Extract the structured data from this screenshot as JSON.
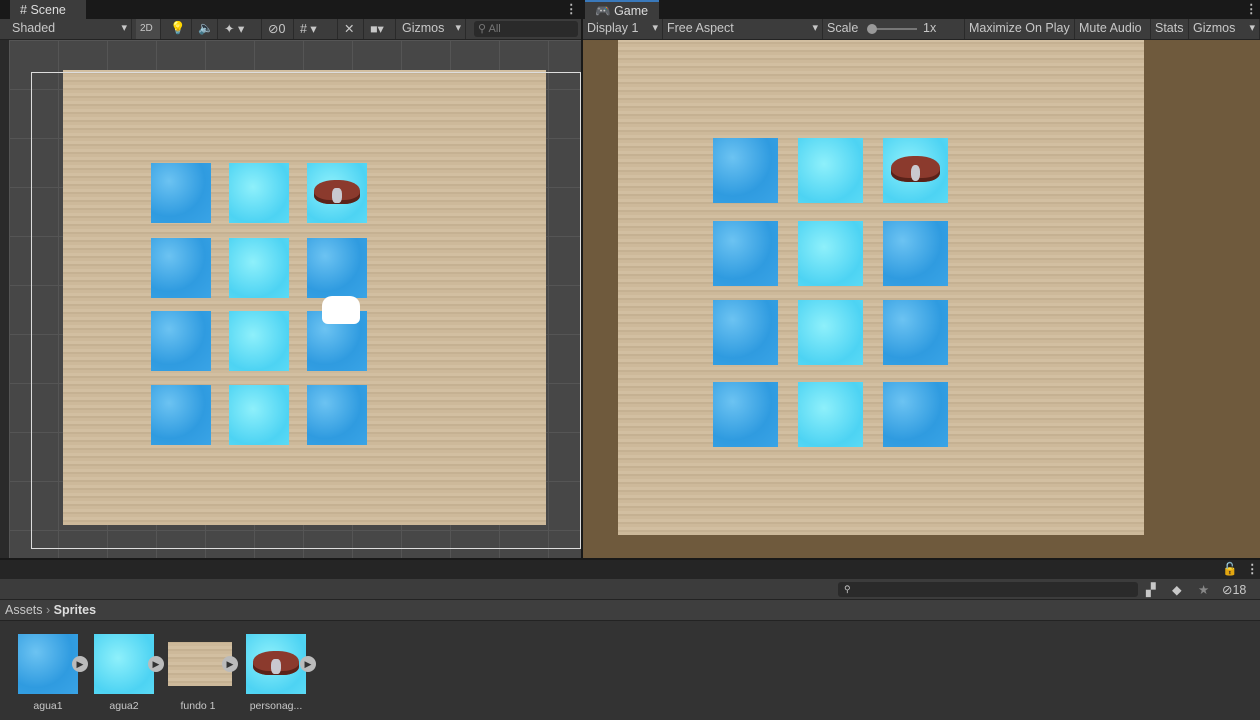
{
  "scene": {
    "tab_label": "Scene",
    "shading_mode": "Shaded",
    "btn_2d": "2D",
    "hidden_count": "0",
    "gizmos": "Gizmos",
    "search_placeholder": "All",
    "grid": [
      [
        "agua1",
        "agua2",
        "personagem"
      ],
      [
        "agua1",
        "agua2",
        "agua1"
      ],
      [
        "agua1",
        "agua2",
        "agua1"
      ],
      [
        "agua1",
        "agua2",
        "agua1"
      ]
    ]
  },
  "game": {
    "tab_label": "Game",
    "display": "Display 1",
    "aspect": "Free Aspect",
    "scale_label": "Scale",
    "scale_value": "1x",
    "scale_fraction": 0,
    "maximize": "Maximize On Play",
    "mute": "Mute Audio",
    "stats": "Stats",
    "gizmos": "Gizmos"
  },
  "project": {
    "hidden_count": "18",
    "breadcrumb": [
      "Assets",
      "Sprites"
    ],
    "assets": [
      {
        "name": "agua1",
        "kind": "agua1"
      },
      {
        "name": "agua2",
        "kind": "agua2"
      },
      {
        "name": "fundo 1",
        "kind": "wood"
      },
      {
        "name": "personag...",
        "kind": "personagem"
      }
    ]
  }
}
